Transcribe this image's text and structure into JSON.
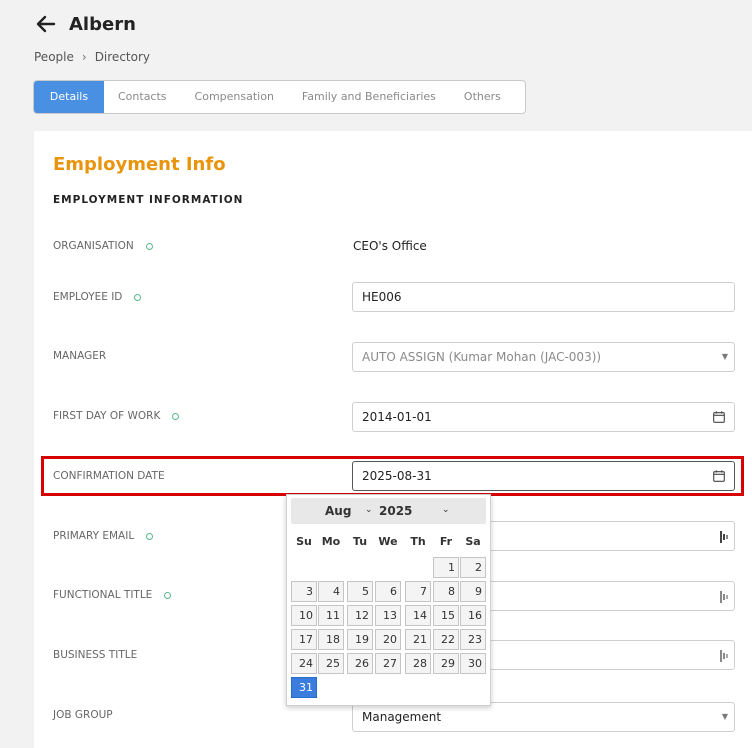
{
  "header": {
    "title": "Albern"
  },
  "breadcrumb": {
    "items": [
      "People",
      "Directory"
    ],
    "separator": "›"
  },
  "tabs": [
    {
      "label": "Details",
      "active": true
    },
    {
      "label": "Contacts",
      "active": false
    },
    {
      "label": "Compensation",
      "active": false
    },
    {
      "label": "Family and Beneficiaries",
      "active": false
    },
    {
      "label": "Others",
      "active": false
    }
  ],
  "section": {
    "title": "Employment Info",
    "subtitle": "EMPLOYMENT INFORMATION"
  },
  "fields": {
    "organisation": {
      "label": "ORGANISATION",
      "value": "CEO's Office"
    },
    "employee_id": {
      "label": "EMPLOYEE ID",
      "value": "HE006"
    },
    "manager": {
      "label": "MANAGER",
      "value": "AUTO ASSIGN (Kumar Mohan (JAC-003))"
    },
    "first_day": {
      "label": "FIRST DAY OF WORK",
      "value": "2014-01-01"
    },
    "confirmation_date": {
      "label": "CONFIRMATION DATE",
      "value": "2025-08-31"
    },
    "primary_email": {
      "label": "PRIMARY EMAIL",
      "value": ""
    },
    "functional_title": {
      "label": "FUNCTIONAL  TITLE",
      "value": ""
    },
    "business_title": {
      "label": "BUSINESS TITLE",
      "value": ""
    },
    "job_group": {
      "label": "JOB GROUP",
      "value": "Management"
    }
  },
  "calendar": {
    "month": "Aug",
    "year": "2025",
    "weekdays": [
      "Su",
      "Mo",
      "Tu",
      "We",
      "Th",
      "Fr",
      "Sa"
    ],
    "first_weekday_index": 5,
    "days_in_month": 31,
    "selected_day": 31
  },
  "colors": {
    "accent": "#e8940c",
    "tab_active": "#4a90e2",
    "highlight": "#d60000",
    "selected_day": "#3b7ddd",
    "required_dot": "#5aba8a"
  }
}
